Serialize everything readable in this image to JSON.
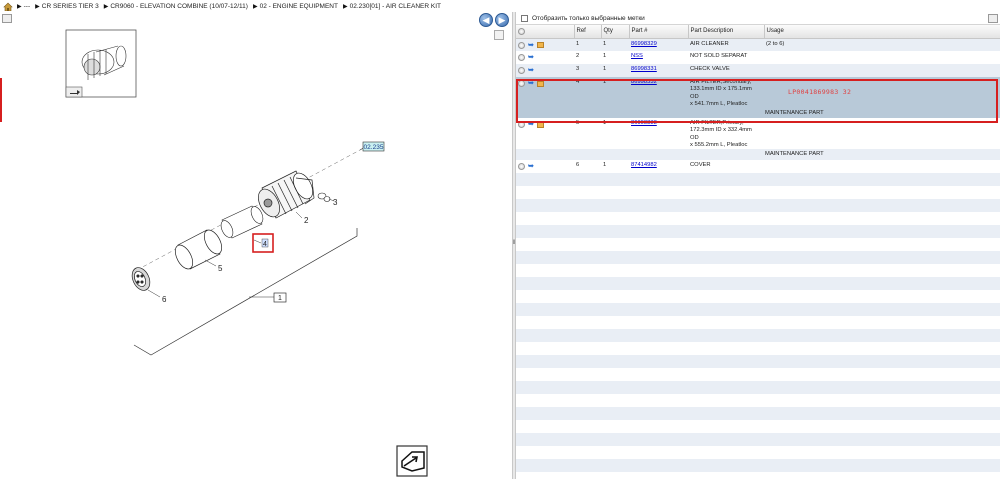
{
  "breadcrumb": {
    "items": [
      "---",
      "CR SERIES TIER 3",
      "CR9060 - ELEVATION COMBINE (10/07-12/11)",
      "02 - ENGINE EQUIPMENT",
      "02.230[01] - AIR CLEANER KIT"
    ]
  },
  "nav": {
    "back_icon": "arrow-left-icon",
    "forward_icon": "arrow-right-icon"
  },
  "diagram": {
    "callouts": [
      "1",
      "2",
      "3",
      "4",
      "5",
      "6"
    ],
    "ref_tag": "02.235",
    "highlighted_callout": "4"
  },
  "filter": {
    "label": "Отобразить только выбранные метки",
    "checked": false
  },
  "table": {
    "columns": [
      "Ref",
      "Qty",
      "Part #",
      "Part Description",
      "Usage"
    ],
    "rows": [
      {
        "ref": "1",
        "qty": "1",
        "part": "86998329",
        "desc": [
          "AIR CLEANER"
        ],
        "usage": "(2 to 6)",
        "note": ""
      },
      {
        "ref": "2",
        "qty": "1",
        "part": "NSS",
        "desc": [
          "NOT SOLD SEPARAT"
        ],
        "usage": "",
        "note": ""
      },
      {
        "ref": "3",
        "qty": "1",
        "part": "86998331",
        "desc": [
          "CHECK VALVE"
        ],
        "usage": "",
        "note": ""
      },
      {
        "ref": "4",
        "qty": "1",
        "part": "86998332",
        "desc": [
          "AIR FILTER,Secondary,",
          "133.1mm ID x 175.1mm OD",
          "x 541.7mm L, Pleatloc"
        ],
        "usage": "",
        "note": "MAINTENANCE PART"
      },
      {
        "ref": "5",
        "qty": "1",
        "part": "86998333",
        "desc": [
          "AIR FILTER,Primary,",
          "172.3mm ID x 332.4mm OD",
          "x 555.2mm L, Pleatloc"
        ],
        "usage": "",
        "note": "MAINTENANCE PART"
      },
      {
        "ref": "6",
        "qty": "1",
        "part": "87414982",
        "desc": [
          "COVER"
        ],
        "usage": "",
        "note": ""
      }
    ],
    "selected_ref": "4"
  },
  "watermark": "LP0041869983 32",
  "colors": {
    "accent": "#3a6db0",
    "selection": "#b8c9d8",
    "highlight_border": "#d61f1f",
    "stripe": "#e9eef5"
  }
}
